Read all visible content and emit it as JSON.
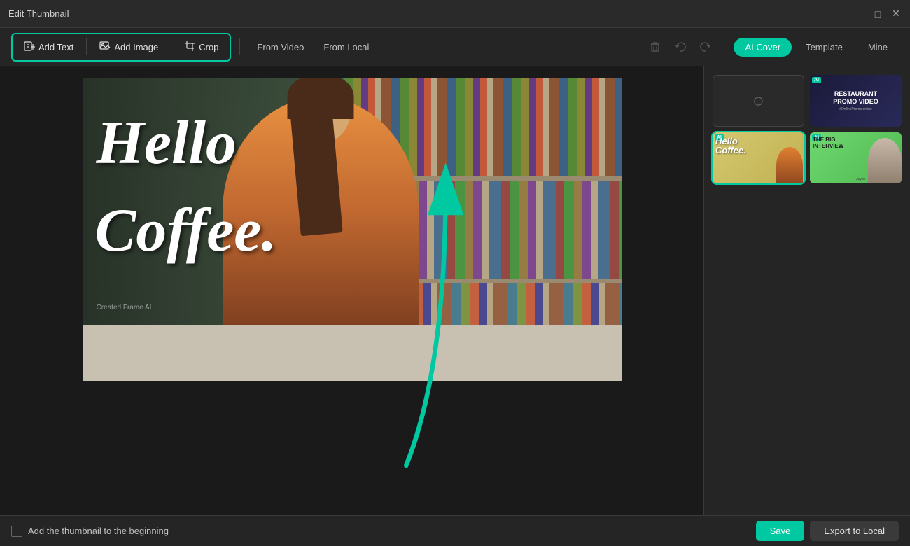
{
  "window": {
    "title": "Edit Thumbnail"
  },
  "toolbar": {
    "add_text_label": "Add Text",
    "add_image_label": "Add Image",
    "crop_label": "Crop",
    "from_video_label": "From Video",
    "from_local_label": "From Local"
  },
  "right_tabs": {
    "ai_cover_label": "AI Cover",
    "template_label": "Template",
    "mine_label": "Mine"
  },
  "templates": [
    {
      "id": "empty",
      "type": "empty",
      "selected": false
    },
    {
      "id": "restaurant",
      "type": "restaurant",
      "selected": false,
      "title": "RESTAURANT PROMO VIDEO"
    },
    {
      "id": "hello_coffee",
      "type": "hello_coffee",
      "selected": true,
      "title": "Hello Coffee"
    },
    {
      "id": "interview",
      "type": "interview",
      "selected": false,
      "title": "THE BIG INTERVIEW",
      "author": "Joyce"
    }
  ],
  "canvas": {
    "text_line1": "Hello",
    "text_line2": "Coffee.",
    "credit": "Created Frame AI"
  },
  "bottom_bar": {
    "checkbox_label": "Add the thumbnail to the beginning",
    "save_label": "Save",
    "export_label": "Export to Local"
  }
}
